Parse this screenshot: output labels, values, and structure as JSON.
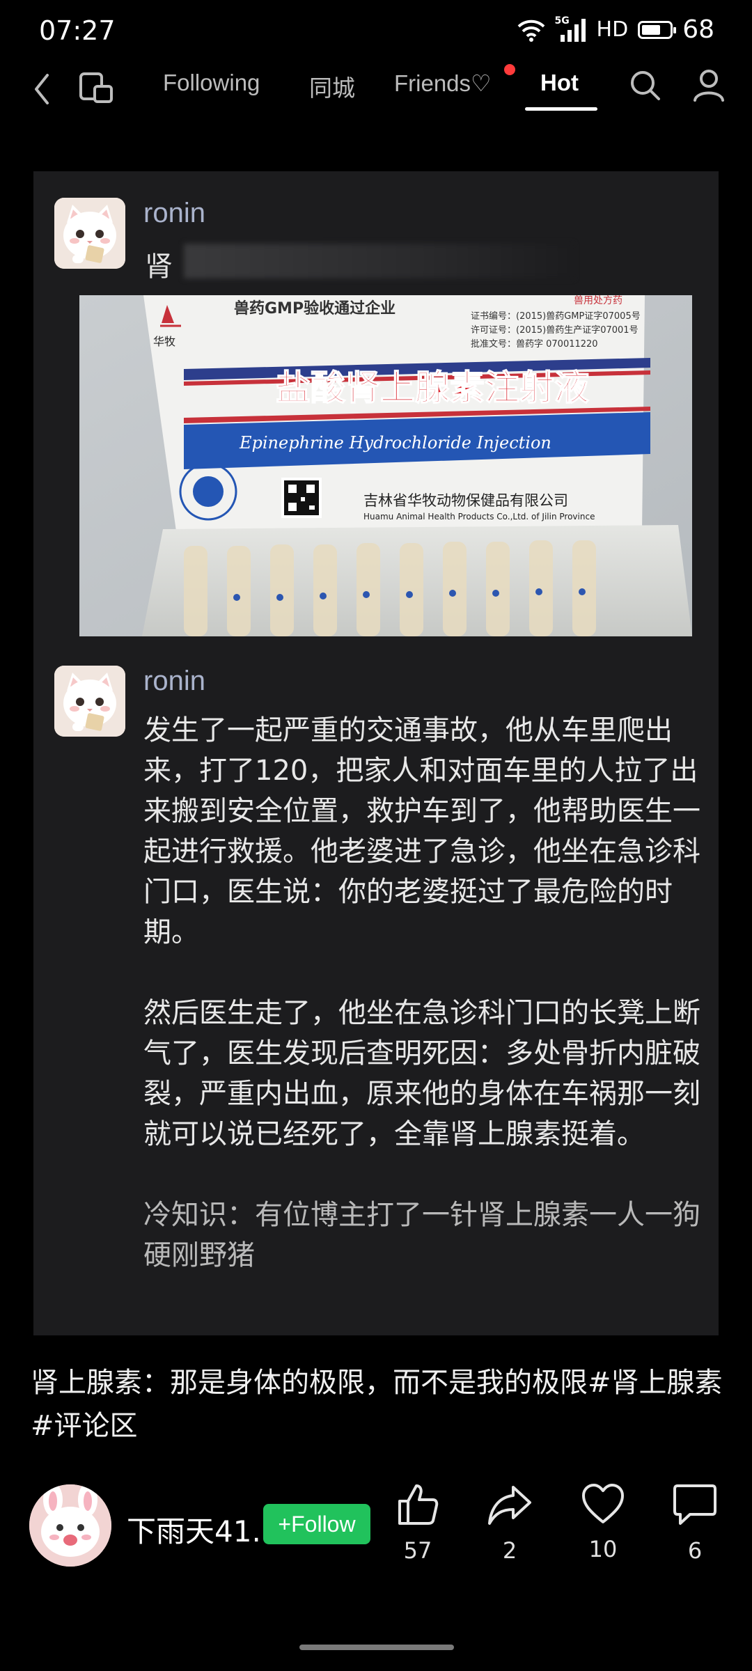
{
  "status_bar": {
    "time": "07:27",
    "network": "5G",
    "hd": "HD",
    "battery": "68",
    "battery_level": 0.68
  },
  "nav": {
    "tabs": [
      {
        "label": "Following"
      },
      {
        "label": "同城"
      },
      {
        "label": "Friends♡"
      },
      {
        "label": "Hot",
        "active": true
      }
    ],
    "friends_has_dot": true
  },
  "post": {
    "comment1": {
      "user": "ronin",
      "text_visible": "肾"
    },
    "photo": {
      "gmp_text": "兽药GMP验收通过企业",
      "brand": "华牧",
      "cert_lines": [
        "证书编号：(2015)兽药GMP证字07005号",
        "许可证号：(2015)兽药生产证字07001号",
        "批准文号：兽药字 070011220"
      ],
      "corner_tag": "兽用处方药",
      "product_cn": "盐酸肾上腺素注射液",
      "product_en": "Epinephrine Hydrochloride Injection",
      "company_cn": "吉林省华牧动物保健品有限公司",
      "company_en": "Huamu Animal Health Products Co.,Ltd. of Jilin Province"
    },
    "comment2": {
      "user": "ronin",
      "paragraphs": [
        "发生了一起严重的交通事故，他从车里爬出来，打了120，把家人和对面车里的人拉了出来搬到安全位置，救护车到了，他帮助医生一起进行救援。他老婆进了急诊，他坐在急诊科门口，医生说：你的老婆挺过了最危险的时期。",
        "然后医生走了，他坐在急诊科门口的长凳上断气了，医生发现后查明死因：多处骨折内脏破裂，严重内出血，原来他的身体在车祸那一刻就可以说已经死了，全靠肾上腺素挺着。",
        "冷知识：有位博主打了一针肾上腺素一人一狗硬刚野猪"
      ]
    }
  },
  "caption": "肾上腺素：那是身体的极限，而不是我的极限#肾上腺素#评论区",
  "author": {
    "name": "下雨天41.",
    "follow_label": "+Follow"
  },
  "actions": [
    {
      "icon": "thumbs-up-icon",
      "count": "57"
    },
    {
      "icon": "share-icon",
      "count": "2"
    },
    {
      "icon": "heart-icon",
      "count": "10"
    },
    {
      "icon": "comment-icon",
      "count": "6"
    }
  ],
  "colors": {
    "follow": "#21c25c",
    "username": "#aab3cc",
    "card": "#1c1c1e",
    "dot": "#ff3b3b"
  }
}
